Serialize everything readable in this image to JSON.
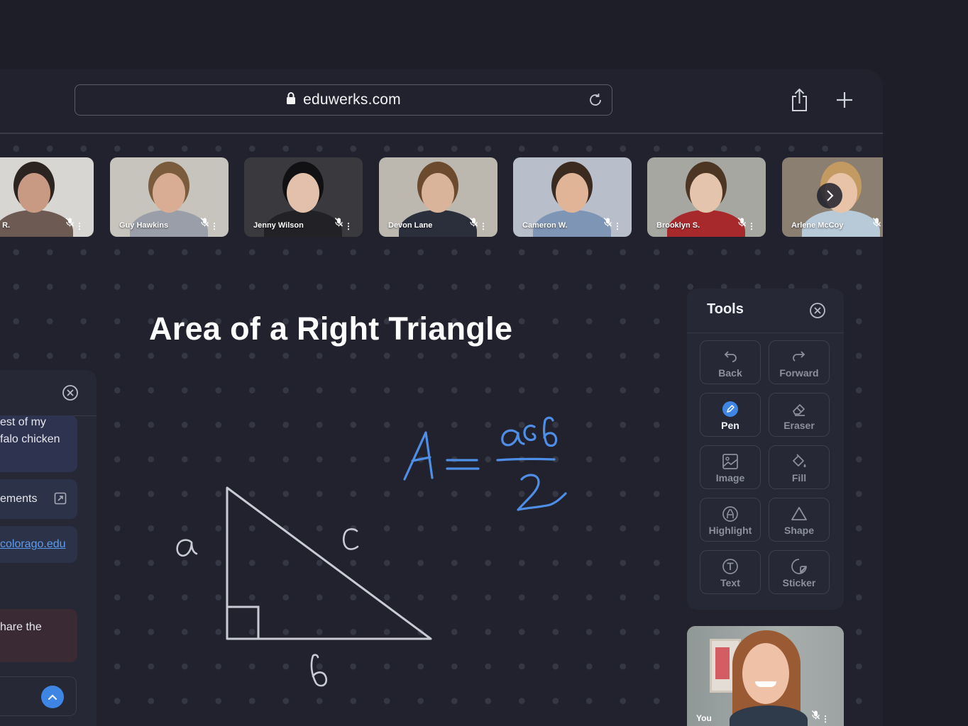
{
  "browser": {
    "url": "eduwerks.com"
  },
  "participants": [
    {
      "name": "lene R.",
      "colors": {
        "bg": "#d8d6d2",
        "face": "#c99a83",
        "body": "#6d5b53",
        "hair": "#2c2420"
      }
    },
    {
      "name": "Guy Hawkins",
      "colors": {
        "bg": "#c7c3bd",
        "face": "#d8ad93",
        "body": "#9a9ea8",
        "hair": "#7a5c3d"
      }
    },
    {
      "name": "Jenny Wilson",
      "colors": {
        "bg": "#3a3a3e",
        "face": "#e2c0ac",
        "body": "#222226",
        "hair": "#111114"
      }
    },
    {
      "name": "Devon Lane",
      "colors": {
        "bg": "#bcb8b0",
        "face": "#d9b49a",
        "body": "#2b2f3c",
        "hair": "#6b4a2e"
      }
    },
    {
      "name": "Cameron  W.",
      "colors": {
        "bg": "#b8bfca",
        "face": "#e0b497",
        "body": "#7f95b5",
        "hair": "#3b2a20"
      }
    },
    {
      "name": "Brooklyn S.",
      "colors": {
        "bg": "#a7a7a2",
        "face": "#e4c4ad",
        "body": "#a8292c",
        "hair": "#4d3523"
      }
    },
    {
      "name": "Arlene McCoy",
      "colors": {
        "bg": "#8b7f72",
        "face": "#e8c3a8",
        "body": "#b8c9d8",
        "hair": "#c49a63"
      }
    }
  ],
  "board": {
    "title": "Area of a Right Triangle",
    "labels": {
      "a": "a",
      "b": "b",
      "c": "c"
    }
  },
  "chat": {
    "messages": [
      {
        "text": "est of my\nfalo chicken"
      },
      {
        "text": "ements"
      },
      {
        "text": "colorago.edu"
      },
      {
        "text": "hare the"
      }
    ]
  },
  "tools": {
    "title": "Tools",
    "items": [
      {
        "label": "Back",
        "icon": "undo-icon"
      },
      {
        "label": "Forward",
        "icon": "redo-icon"
      },
      {
        "label": "Pen",
        "icon": "pen-icon",
        "active": true
      },
      {
        "label": "Eraser",
        "icon": "eraser-icon"
      },
      {
        "label": "Image",
        "icon": "image-icon"
      },
      {
        "label": "Fill",
        "icon": "fill-icon"
      },
      {
        "label": "Highlight",
        "icon": "highlight-icon"
      },
      {
        "label": "Shape",
        "icon": "shape-icon"
      },
      {
        "label": "Text",
        "icon": "text-icon"
      },
      {
        "label": "Sticker",
        "icon": "sticker-icon"
      }
    ]
  },
  "self_view": {
    "name": "You"
  },
  "colors": {
    "accent": "#3f86e4",
    "ink": "#4e8ee6",
    "chalk": "#c9cbd4"
  }
}
